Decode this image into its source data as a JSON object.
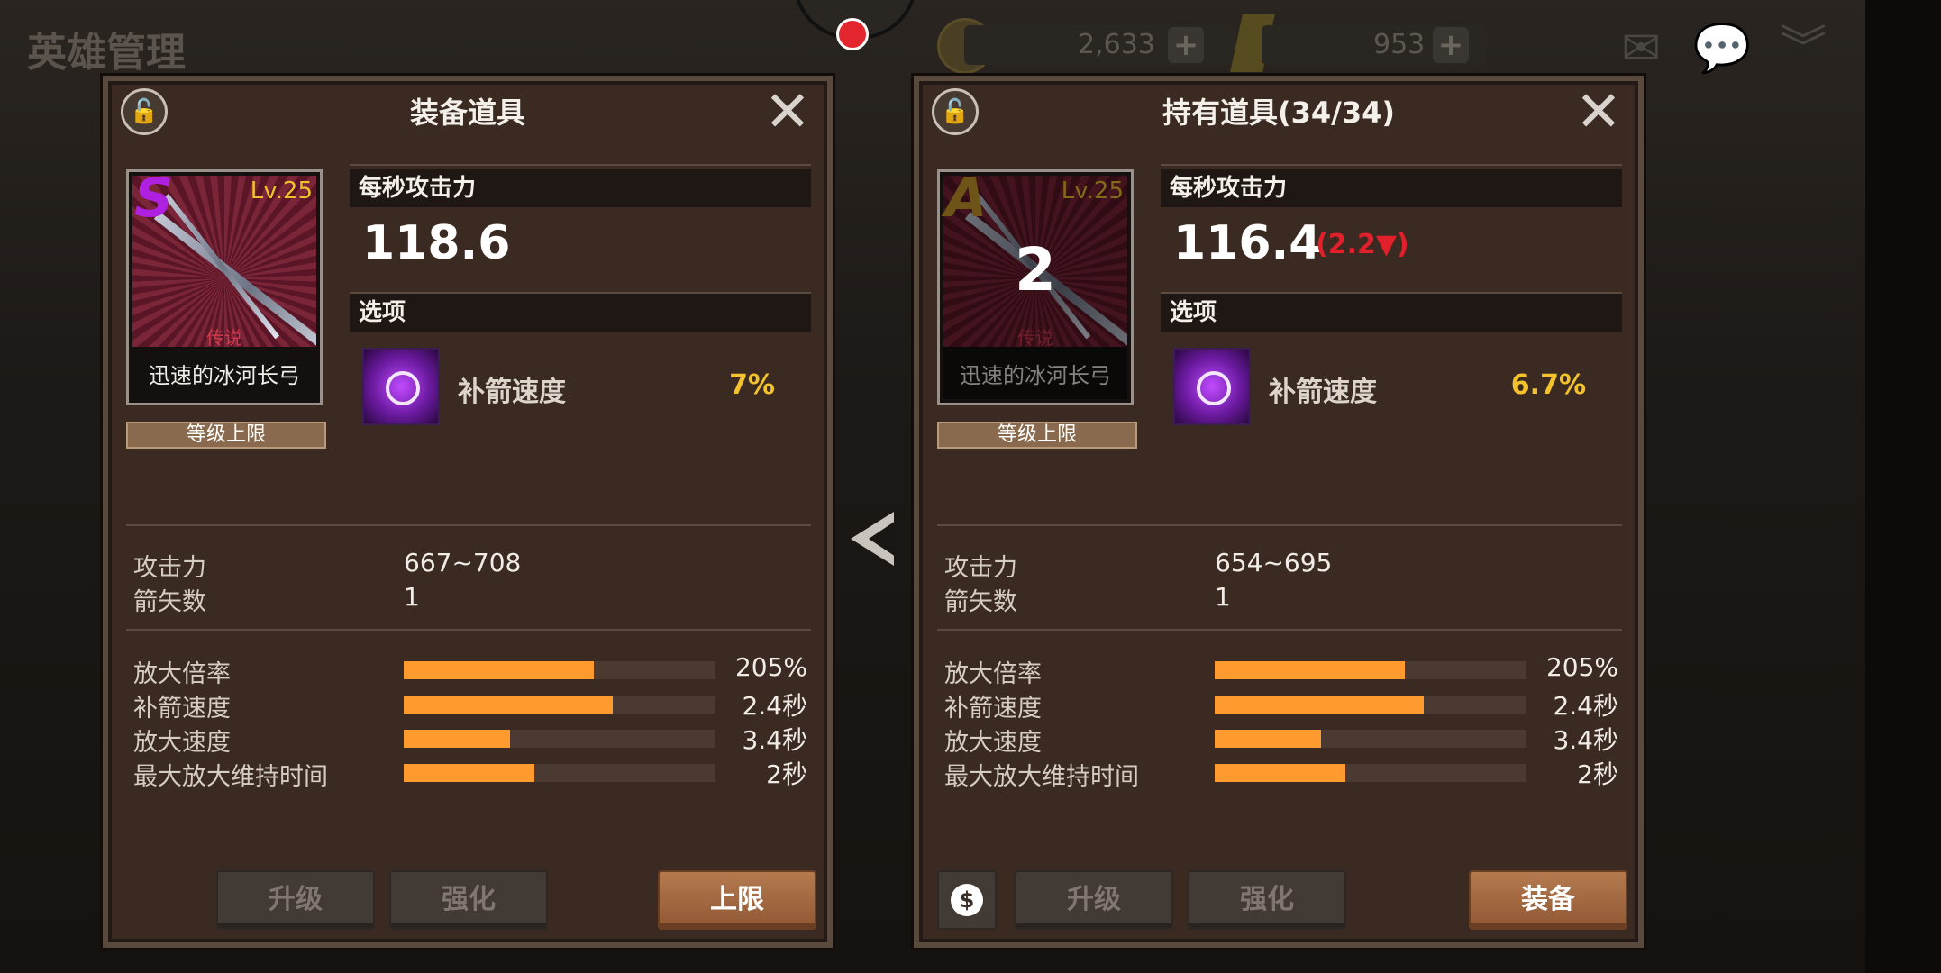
{
  "top": {
    "title": "英雄管理",
    "coins": "2,633",
    "gold": "953",
    "plus": "+",
    "icons": [
      "mail-icon",
      "chat-icon",
      "collapse-icon"
    ]
  },
  "left": {
    "title": "装备道具",
    "lock": "🔓",
    "close": "✕",
    "grade": "S",
    "grade_color": "#b020e0",
    "level": "Lv.25",
    "rarity": "传说",
    "item_name": "迅速的冰河长弓",
    "level_cap": "等级上限",
    "dps_header": "每秒攻击力",
    "dps": "118.6",
    "option_header": "选项",
    "option_name": "补箭速度",
    "option_value": "7%",
    "attack_label": "攻击力",
    "attack_value": "667~708",
    "arrows_label": "箭矢数",
    "arrows_value": "1",
    "bars": [
      {
        "label": "放大倍率",
        "fraction": 0.61,
        "value": "205%"
      },
      {
        "label": "补箭速度",
        "fraction": 0.67,
        "value": "2.4秒"
      },
      {
        "label": "放大速度",
        "fraction": 0.34,
        "value": "3.4秒"
      },
      {
        "label": "最大放大维持时间",
        "fraction": 0.42,
        "value": "2秒"
      }
    ],
    "btn_upgrade": "升级",
    "btn_enhance": "强化",
    "btn_main": "上限"
  },
  "right": {
    "title": "持有道具(34/34)",
    "lock": "🔓",
    "close": "✕",
    "grade": "A",
    "grade_color": "#c89a2a",
    "level": "Lv.25",
    "count": "2",
    "rarity": "传说",
    "item_name": "迅速的冰河长弓",
    "level_cap": "等级上限",
    "dps_header": "每秒攻击力",
    "dps": "116.4",
    "dps_diff": "(2.2▼)",
    "option_header": "选项",
    "option_name": "补箭速度",
    "option_value": "6.7%",
    "attack_label": "攻击力",
    "attack_value": "654~695",
    "arrows_label": "箭矢数",
    "arrows_value": "1",
    "bars": [
      {
        "label": "放大倍率",
        "fraction": 0.61,
        "value": "205%"
      },
      {
        "label": "补箭速度",
        "fraction": 0.67,
        "value": "2.4秒"
      },
      {
        "label": "放大速度",
        "fraction": 0.34,
        "value": "3.4秒"
      },
      {
        "label": "最大放大维持时间",
        "fraction": 0.42,
        "value": "2秒"
      }
    ],
    "coin_icon": "$",
    "btn_upgrade": "升级",
    "btn_enhance": "强化",
    "btn_main": "装备"
  }
}
